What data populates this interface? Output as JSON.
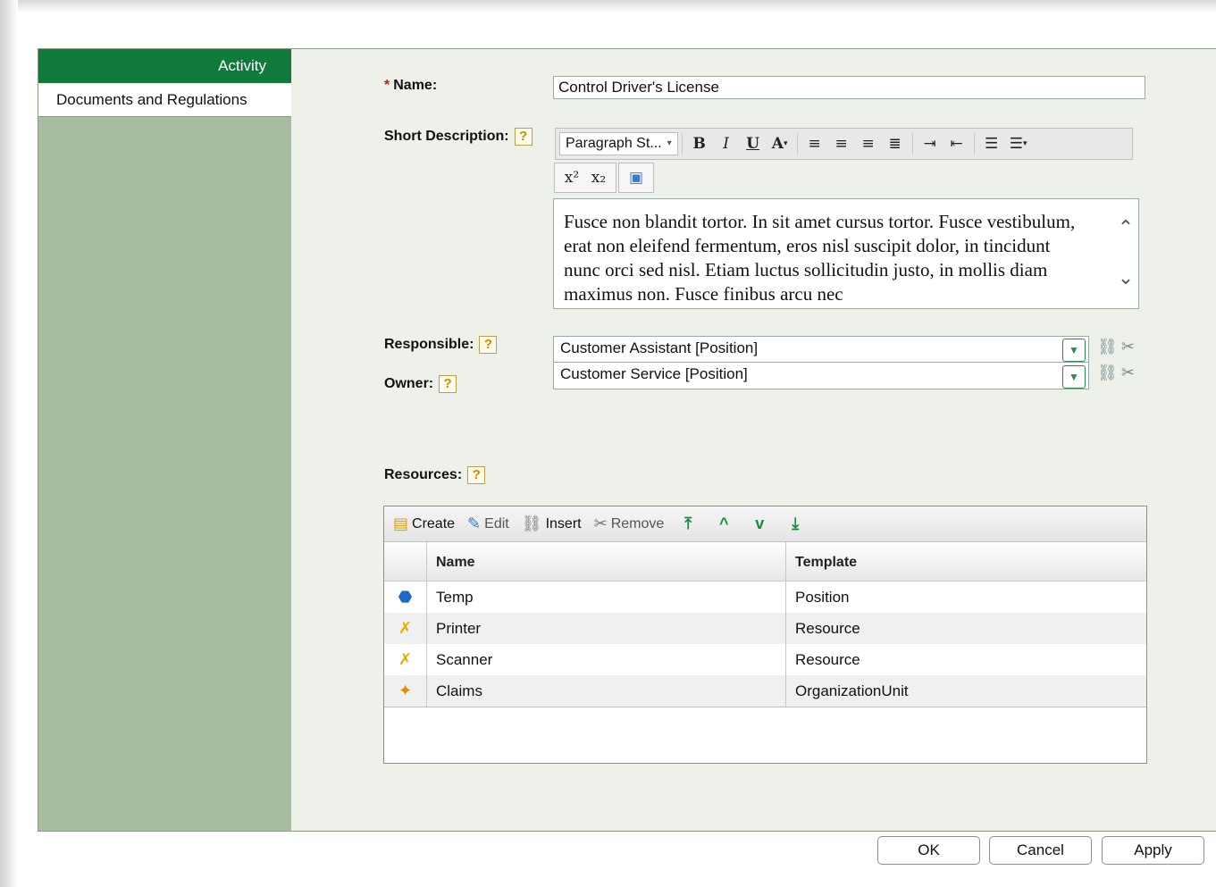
{
  "nav": {
    "items": [
      {
        "label": "Activity",
        "active": true
      },
      {
        "label": "Documents and Regulations",
        "active": false
      }
    ]
  },
  "form": {
    "name_label": "Name:",
    "name_required_mark": "*",
    "name_value": "Control Driver's License",
    "short_desc_label": "Short Description:",
    "help_glyph": "?",
    "editor": {
      "paragraph_style": "Paragraph St...",
      "text": "Fusce non blandit tortor. In sit amet cursus tortor. Fusce vestibulum, erat non eleifend fermentum, eros nisl suscipit dolor, in tincidunt nunc orci sed nisl. Etiam luctus sollicitudin justo, in mollis diam maximus non. Fusce finibus arcu nec"
    },
    "responsible_label": "Responsible:",
    "responsible_value": "Customer Assistant [Position]",
    "owner_label": "Owner:",
    "owner_value": "Customer Service [Position]",
    "resources_label": "Resources:"
  },
  "resources": {
    "toolbar": {
      "create": "Create",
      "edit": "Edit",
      "insert": "Insert",
      "remove": "Remove"
    },
    "columns": {
      "name": "Name",
      "template": "Template"
    },
    "rows": [
      {
        "icon": "position-icon",
        "name": "Temp",
        "template": "Position"
      },
      {
        "icon": "resource-icon",
        "name": "Printer",
        "template": "Resource"
      },
      {
        "icon": "resource-icon",
        "name": "Scanner",
        "template": "Resource"
      },
      {
        "icon": "organization-unit-icon",
        "name": "Claims",
        "template": "OrganizationUnit"
      }
    ]
  },
  "footer": {
    "ok": "OK",
    "cancel": "Cancel",
    "apply": "Apply"
  },
  "colors": {
    "nav_active": "#0f7a3a",
    "nav_bg": "#a8bca0",
    "panel_bg": "#edf1ea",
    "accent_green": "#2a8a4a"
  }
}
